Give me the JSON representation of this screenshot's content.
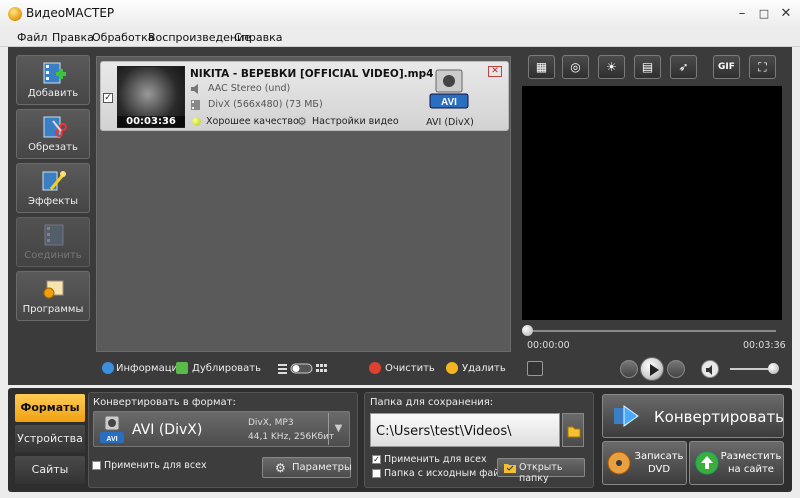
{
  "window": {
    "title": "ВидеоМАСТЕР",
    "minimize": "–",
    "maximize": "□",
    "close": "✕"
  },
  "menu": [
    "Файл",
    "Правка",
    "Обработка",
    "Воспроизведение",
    "Справка"
  ],
  "sidebar": {
    "items": [
      {
        "label": "Добавить",
        "icon": "film-add-icon",
        "enabled": true
      },
      {
        "label": "Обрезать",
        "icon": "film-cut-icon",
        "enabled": true
      },
      {
        "label": "Эффекты",
        "icon": "magic-wand-icon",
        "enabled": true
      },
      {
        "label": "Соединить",
        "icon": "film-join-icon",
        "enabled": false
      },
      {
        "label": "Программы",
        "icon": "programs-icon",
        "enabled": true
      }
    ]
  },
  "file": {
    "name": "NIKITA - ВЕРЕВКИ [OFFICIAL VIDEO].mp4",
    "duration": "00:03:36",
    "audio": "AAC Stereo (und)",
    "video": "DivX (566x480) (73 МБ)",
    "quality": "Хорошее качество",
    "settings": "Настройки видео",
    "format_badge": "AVI",
    "format_label": "AVI (DivX)",
    "checked": "✓",
    "remove": "✕"
  },
  "toolbar": {
    "info": "Информация",
    "duplicate": "Дублировать",
    "clear": "Очистить",
    "delete": "Удалить"
  },
  "preview": {
    "toolbar_icons": [
      "crop-icon",
      "rotate-icon",
      "brightness-icon",
      "film-frame-icon",
      "speed-run-icon",
      "gif-icon",
      "fullscreen-icon"
    ],
    "gif_label": "GIF",
    "time_start": "00:00:00",
    "time_end": "00:03:36",
    "position": 0.0,
    "volume": 1.0
  },
  "tabs": {
    "formats": "Форматы",
    "devices": "Устройства",
    "sites": "Сайты"
  },
  "convert": {
    "title": "Конвертировать в формат:",
    "format_name": "AVI (DivX)",
    "format_badge": "AVI",
    "detail1": "DivX, MP3",
    "detail2": "44,1 KHz, 256Кбит",
    "apply_all": "Применить для всех",
    "params": "Параметры"
  },
  "save": {
    "title": "Папка для сохранения:",
    "path": "C:\\Users\\test\\Videos\\",
    "apply_all": "Применить для всех",
    "source_folder": "Папка с исходным файлом",
    "open_folder": "Открыть папку"
  },
  "actions": {
    "convert": "Конвертировать",
    "dvd_line1": "Записать",
    "dvd_line2": "DVD",
    "web_line1": "Разместить",
    "web_line2": "на сайте"
  },
  "colors": {
    "accent": "#f0a010",
    "panel": "#3b3b3b"
  }
}
